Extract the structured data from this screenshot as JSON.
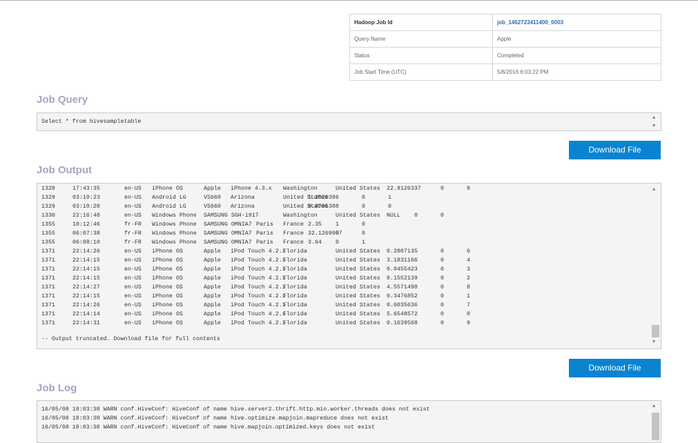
{
  "job_info": {
    "rows": [
      {
        "label": "Hadoop Job Id",
        "value": "job_1462723411400_0003"
      },
      {
        "label": "Query Name",
        "value": "Apple"
      },
      {
        "label": "Status",
        "value": "Completed"
      },
      {
        "label": "Job Start Time (UTC)",
        "value": "5/8/2016 6:03:22 PM"
      }
    ]
  },
  "query": {
    "title": "Job Query",
    "text": "Select * from hivesampletable"
  },
  "output": {
    "title": "Job Output",
    "download_label": "Download File",
    "rows": [
      [
        "1328",
        "17:43:35",
        "en-US",
        "iPhone OS",
        "Apple",
        "iPhone 4.3.x",
        "Washington",
        "United States",
        "22.9126337",
        "0",
        "0"
      ],
      [
        "1329",
        "03:10:23",
        "en-US",
        "Android LG",
        "VS660",
        "Arizona",
        "United States",
        "1.3820386",
        "0",
        "1",
        ""
      ],
      [
        "1329",
        "03:10:20",
        "en-US",
        "Android LG",
        "VS660",
        "Arizona",
        "United States",
        "9.8795388",
        "0",
        "0",
        ""
      ],
      [
        "1330",
        "22:16:48",
        "en-US",
        "Windows Phone",
        "SAMSUNG SGH-i917",
        "Washington",
        "United States",
        "NULL",
        "0",
        "0",
        ""
      ],
      [
        "1355",
        "10:12:46",
        "fr-FR",
        "Windows Phone",
        "SAMSUNG OMNIA7",
        "Paris",
        "France",
        "2.35",
        "1",
        "0",
        ""
      ],
      [
        "1355",
        "06:07:38",
        "fr-FR",
        "Windows Phone",
        "SAMSUNG OMNIA7",
        "Paris",
        "France",
        "32.1269957",
        "0",
        "0",
        ""
      ],
      [
        "1355",
        "06:08:10",
        "fr-FR",
        "Windows Phone",
        "SAMSUNG OMNIA7",
        "Paris",
        "France",
        "3.64",
        "0",
        "1",
        ""
      ],
      [
        "1371",
        "22:14:26",
        "en-US",
        "iPhone OS",
        "Apple",
        "iPod Touch 4.2.1",
        "Florida",
        "United States",
        "0.2807135",
        "0",
        "6"
      ],
      [
        "1371",
        "22:14:15",
        "en-US",
        "iPhone OS",
        "Apple",
        "iPod Touch 4.2.1",
        "Florida",
        "United States",
        "3.1831166",
        "0",
        "4"
      ],
      [
        "1371",
        "22:14:15",
        "en-US",
        "iPhone OS",
        "Apple",
        "iPod Touch 4.2.1",
        "Florida",
        "United States",
        "0.0455423",
        "0",
        "3"
      ],
      [
        "1371",
        "22:14:15",
        "en-US",
        "iPhone OS",
        "Apple",
        "iPod Touch 4.2.1",
        "Florida",
        "United States",
        "0.1552139",
        "0",
        "2"
      ],
      [
        "1371",
        "22:14:27",
        "en-US",
        "iPhone OS",
        "Apple",
        "iPod Touch 4.2.1",
        "Florida",
        "United States",
        "4.5571498",
        "0",
        "8"
      ],
      [
        "1371",
        "22:14:15",
        "en-US",
        "iPhone OS",
        "Apple",
        "iPod Touch 4.2.1",
        "Florida",
        "United States",
        "0.3476852",
        "0",
        "1"
      ],
      [
        "1371",
        "22:14:26",
        "en-US",
        "iPhone OS",
        "Apple",
        "iPod Touch 4.2.1",
        "Florida",
        "United States",
        "0.6035636",
        "0",
        "7"
      ],
      [
        "1371",
        "22:14:14",
        "en-US",
        "iPhone OS",
        "Apple",
        "iPod Touch 4.2.1",
        "Florida",
        "United States",
        "5.6548572",
        "0",
        "0"
      ],
      [
        "1371",
        "22:14:31",
        "en-US",
        "iPhone OS",
        "Apple",
        "iPod Touch 4.2.1",
        "Florida",
        "United States",
        "0.1639568",
        "0",
        "9"
      ]
    ],
    "truncated_note": "-- Output truncated. Download file for full contents"
  },
  "query_download_label": "Download File",
  "log": {
    "title": "Job Log",
    "lines": [
      "16/05/08 18:03:38 WARN conf.HiveConf: HiveConf of name hive.server2.thrift.http.min.worker.threads does not exist",
      "16/05/08 18:03:38 WARN conf.HiveConf: HiveConf of name hive.optimize.mapjoin.mapreduce does not exist",
      "16/05/08 18:03:38 WARN conf.HiveConf: HiveConf of name hive.mapjoin.optimized.keys does not exist"
    ]
  },
  "icons": {
    "scroll_up": "▲",
    "scroll_down": "▼"
  }
}
